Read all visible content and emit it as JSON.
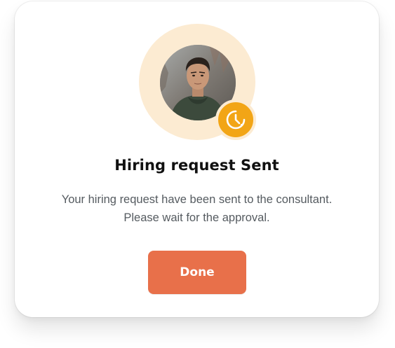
{
  "dialog": {
    "title": "Hiring request Sent",
    "message_line1": "Your hiring request have been sent to the consultant.",
    "message_line2": "Please wait for the approval.",
    "done_label": "Done"
  },
  "icons": {
    "status_icon": "clock-icon"
  },
  "colors": {
    "accent": "#e8704a",
    "avatar_ring": "#fcebd2",
    "badge": "#f2a516",
    "title": "#111111",
    "body_text": "#555b60"
  }
}
